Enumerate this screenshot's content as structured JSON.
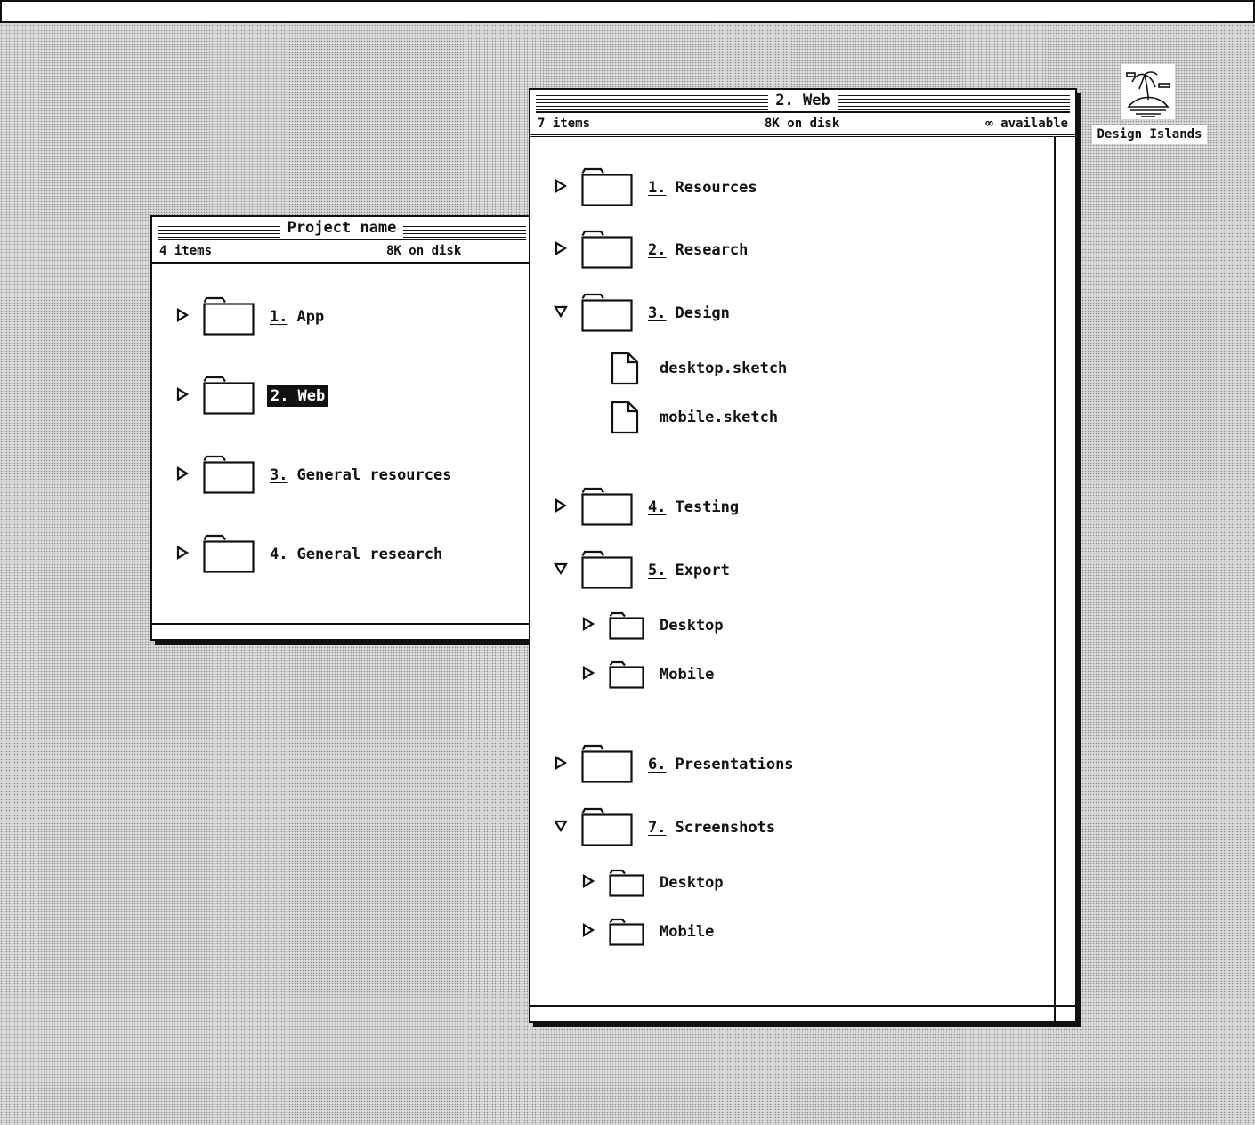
{
  "desktop": {
    "icon_name": "island-icon",
    "icon_label": "Design Islands"
  },
  "window_project": {
    "title": "Project name",
    "items_count": "4 items",
    "disk_usage": "8K on disk",
    "rows": [
      {
        "num": "1.",
        "name": "App",
        "selected": false
      },
      {
        "num": "2.",
        "name": "Web",
        "selected": true
      },
      {
        "num": "3.",
        "name": "General resources",
        "selected": false
      },
      {
        "num": "4.",
        "name": "General research",
        "selected": false
      }
    ]
  },
  "window_web": {
    "title": "2. Web",
    "items_count": "7 items",
    "disk_usage": "8K on disk",
    "available": "∞ available",
    "rows": [
      {
        "num": "1.",
        "name": "Resources",
        "expanded": false
      },
      {
        "num": "2.",
        "name": "Research",
        "expanded": false
      },
      {
        "num": "3.",
        "name": "Design",
        "expanded": true
      },
      {
        "name": "desktop.sketch",
        "type": "file"
      },
      {
        "name": "mobile.sketch",
        "type": "file"
      },
      {
        "num": "4.",
        "name": "Testing",
        "expanded": false
      },
      {
        "num": "5.",
        "name": "Export",
        "expanded": true
      },
      {
        "name": "Desktop",
        "type": "subfolder"
      },
      {
        "name": "Mobile",
        "type": "subfolder"
      },
      {
        "num": "6.",
        "name": "Presentations",
        "expanded": false
      },
      {
        "num": "7.",
        "name": "Screenshots",
        "expanded": true
      },
      {
        "name": "Desktop",
        "type": "subfolder"
      },
      {
        "name": "Mobile",
        "type": "subfolder"
      }
    ]
  }
}
